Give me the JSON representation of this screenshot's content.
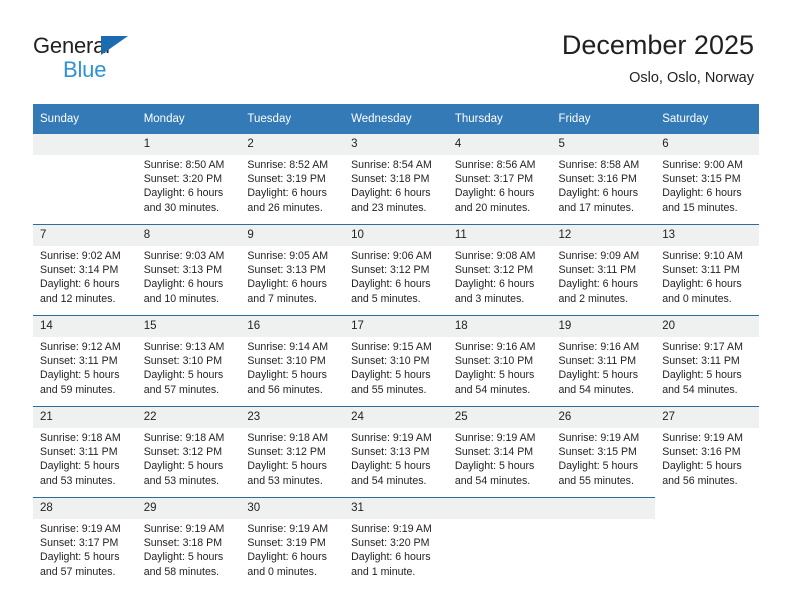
{
  "brand": {
    "name_top": "General",
    "name_bottom": "Blue",
    "color_dark": "#231f20",
    "color_blue": "#2e92d6",
    "triangle_color": "#1b6bb0"
  },
  "header": {
    "title": "December 2025",
    "subtitle": "Oslo, Oslo, Norway"
  },
  "theme": {
    "header_row_bg": "#337ab7",
    "header_row_text": "#ffffff",
    "daynum_bg": "#eff0f0",
    "row_divider": "#2b6ca3",
    "body_text": "#231f20"
  },
  "weekday_headers": [
    "Sunday",
    "Monday",
    "Tuesday",
    "Wednesday",
    "Thursday",
    "Friday",
    "Saturday"
  ],
  "labels": {
    "sunrise_prefix": "Sunrise:",
    "sunset_prefix": "Sunset:",
    "daylight_prefix": "Daylight:"
  },
  "weeks": [
    [
      {
        "day": "",
        "empty": true,
        "line1": "",
        "line2": "",
        "line3": "",
        "line4": ""
      },
      {
        "day": "1",
        "line1": "Sunrise: 8:50 AM",
        "line2": "Sunset: 3:20 PM",
        "line3": "Daylight: 6 hours",
        "line4": "and 30 minutes."
      },
      {
        "day": "2",
        "line1": "Sunrise: 8:52 AM",
        "line2": "Sunset: 3:19 PM",
        "line3": "Daylight: 6 hours",
        "line4": "and 26 minutes."
      },
      {
        "day": "3",
        "line1": "Sunrise: 8:54 AM",
        "line2": "Sunset: 3:18 PM",
        "line3": "Daylight: 6 hours",
        "line4": "and 23 minutes."
      },
      {
        "day": "4",
        "line1": "Sunrise: 8:56 AM",
        "line2": "Sunset: 3:17 PM",
        "line3": "Daylight: 6 hours",
        "line4": "and 20 minutes."
      },
      {
        "day": "5",
        "line1": "Sunrise: 8:58 AM",
        "line2": "Sunset: 3:16 PM",
        "line3": "Daylight: 6 hours",
        "line4": "and 17 minutes."
      },
      {
        "day": "6",
        "line1": "Sunrise: 9:00 AM",
        "line2": "Sunset: 3:15 PM",
        "line3": "Daylight: 6 hours",
        "line4": "and 15 minutes."
      }
    ],
    [
      {
        "day": "7",
        "line1": "Sunrise: 9:02 AM",
        "line2": "Sunset: 3:14 PM",
        "line3": "Daylight: 6 hours",
        "line4": "and 12 minutes."
      },
      {
        "day": "8",
        "line1": "Sunrise: 9:03 AM",
        "line2": "Sunset: 3:13 PM",
        "line3": "Daylight: 6 hours",
        "line4": "and 10 minutes."
      },
      {
        "day": "9",
        "line1": "Sunrise: 9:05 AM",
        "line2": "Sunset: 3:13 PM",
        "line3": "Daylight: 6 hours",
        "line4": "and 7 minutes."
      },
      {
        "day": "10",
        "line1": "Sunrise: 9:06 AM",
        "line2": "Sunset: 3:12 PM",
        "line3": "Daylight: 6 hours",
        "line4": "and 5 minutes."
      },
      {
        "day": "11",
        "line1": "Sunrise: 9:08 AM",
        "line2": "Sunset: 3:12 PM",
        "line3": "Daylight: 6 hours",
        "line4": "and 3 minutes."
      },
      {
        "day": "12",
        "line1": "Sunrise: 9:09 AM",
        "line2": "Sunset: 3:11 PM",
        "line3": "Daylight: 6 hours",
        "line4": "and 2 minutes."
      },
      {
        "day": "13",
        "line1": "Sunrise: 9:10 AM",
        "line2": "Sunset: 3:11 PM",
        "line3": "Daylight: 6 hours",
        "line4": "and 0 minutes."
      }
    ],
    [
      {
        "day": "14",
        "line1": "Sunrise: 9:12 AM",
        "line2": "Sunset: 3:11 PM",
        "line3": "Daylight: 5 hours",
        "line4": "and 59 minutes."
      },
      {
        "day": "15",
        "line1": "Sunrise: 9:13 AM",
        "line2": "Sunset: 3:10 PM",
        "line3": "Daylight: 5 hours",
        "line4": "and 57 minutes."
      },
      {
        "day": "16",
        "line1": "Sunrise: 9:14 AM",
        "line2": "Sunset: 3:10 PM",
        "line3": "Daylight: 5 hours",
        "line4": "and 56 minutes."
      },
      {
        "day": "17",
        "line1": "Sunrise: 9:15 AM",
        "line2": "Sunset: 3:10 PM",
        "line3": "Daylight: 5 hours",
        "line4": "and 55 minutes."
      },
      {
        "day": "18",
        "line1": "Sunrise: 9:16 AM",
        "line2": "Sunset: 3:10 PM",
        "line3": "Daylight: 5 hours",
        "line4": "and 54 minutes."
      },
      {
        "day": "19",
        "line1": "Sunrise: 9:16 AM",
        "line2": "Sunset: 3:11 PM",
        "line3": "Daylight: 5 hours",
        "line4": "and 54 minutes."
      },
      {
        "day": "20",
        "line1": "Sunrise: 9:17 AM",
        "line2": "Sunset: 3:11 PM",
        "line3": "Daylight: 5 hours",
        "line4": "and 54 minutes."
      }
    ],
    [
      {
        "day": "21",
        "line1": "Sunrise: 9:18 AM",
        "line2": "Sunset: 3:11 PM",
        "line3": "Daylight: 5 hours",
        "line4": "and 53 minutes."
      },
      {
        "day": "22",
        "line1": "Sunrise: 9:18 AM",
        "line2": "Sunset: 3:12 PM",
        "line3": "Daylight: 5 hours",
        "line4": "and 53 minutes."
      },
      {
        "day": "23",
        "line1": "Sunrise: 9:18 AM",
        "line2": "Sunset: 3:12 PM",
        "line3": "Daylight: 5 hours",
        "line4": "and 53 minutes."
      },
      {
        "day": "24",
        "line1": "Sunrise: 9:19 AM",
        "line2": "Sunset: 3:13 PM",
        "line3": "Daylight: 5 hours",
        "line4": "and 54 minutes."
      },
      {
        "day": "25",
        "line1": "Sunrise: 9:19 AM",
        "line2": "Sunset: 3:14 PM",
        "line3": "Daylight: 5 hours",
        "line4": "and 54 minutes."
      },
      {
        "day": "26",
        "line1": "Sunrise: 9:19 AM",
        "line2": "Sunset: 3:15 PM",
        "line3": "Daylight: 5 hours",
        "line4": "and 55 minutes."
      },
      {
        "day": "27",
        "line1": "Sunrise: 9:19 AM",
        "line2": "Sunset: 3:16 PM",
        "line3": "Daylight: 5 hours",
        "line4": "and 56 minutes."
      }
    ],
    [
      {
        "day": "28",
        "line1": "Sunrise: 9:19 AM",
        "line2": "Sunset: 3:17 PM",
        "line3": "Daylight: 5 hours",
        "line4": "and 57 minutes."
      },
      {
        "day": "29",
        "line1": "Sunrise: 9:19 AM",
        "line2": "Sunset: 3:18 PM",
        "line3": "Daylight: 5 hours",
        "line4": "and 58 minutes."
      },
      {
        "day": "30",
        "line1": "Sunrise: 9:19 AM",
        "line2": "Sunset: 3:19 PM",
        "line3": "Daylight: 6 hours",
        "line4": "and 0 minutes."
      },
      {
        "day": "31",
        "line1": "Sunrise: 9:19 AM",
        "line2": "Sunset: 3:20 PM",
        "line3": "Daylight: 6 hours",
        "line4": "and 1 minute."
      },
      {
        "day": "",
        "empty": true,
        "line1": "",
        "line2": "",
        "line3": "",
        "line4": ""
      },
      {
        "day": "",
        "empty": true,
        "line1": "",
        "line2": "",
        "line3": "",
        "line4": ""
      },
      {
        "day": "",
        "blank_end": true,
        "line1": "",
        "line2": "",
        "line3": "",
        "line4": ""
      }
    ]
  ]
}
